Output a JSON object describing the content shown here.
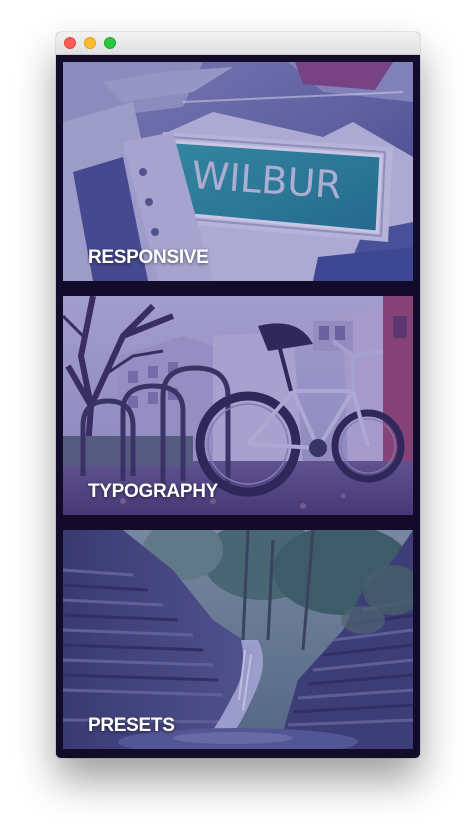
{
  "window": {
    "controls": [
      "close",
      "minimize",
      "zoom"
    ]
  },
  "cards": [
    {
      "label": "RESPONSIVE",
      "image": "wilbur-sign-photo",
      "sign_text": "WILBUR"
    },
    {
      "label": "TYPOGRAPHY",
      "image": "bicycle-photo"
    },
    {
      "label": "PRESETS",
      "image": "canyon-waterfall-photo"
    }
  ],
  "colors": {
    "background": "#120c2a",
    "overlay_tint": "#3c32a0",
    "label_text": "#ffffff"
  }
}
